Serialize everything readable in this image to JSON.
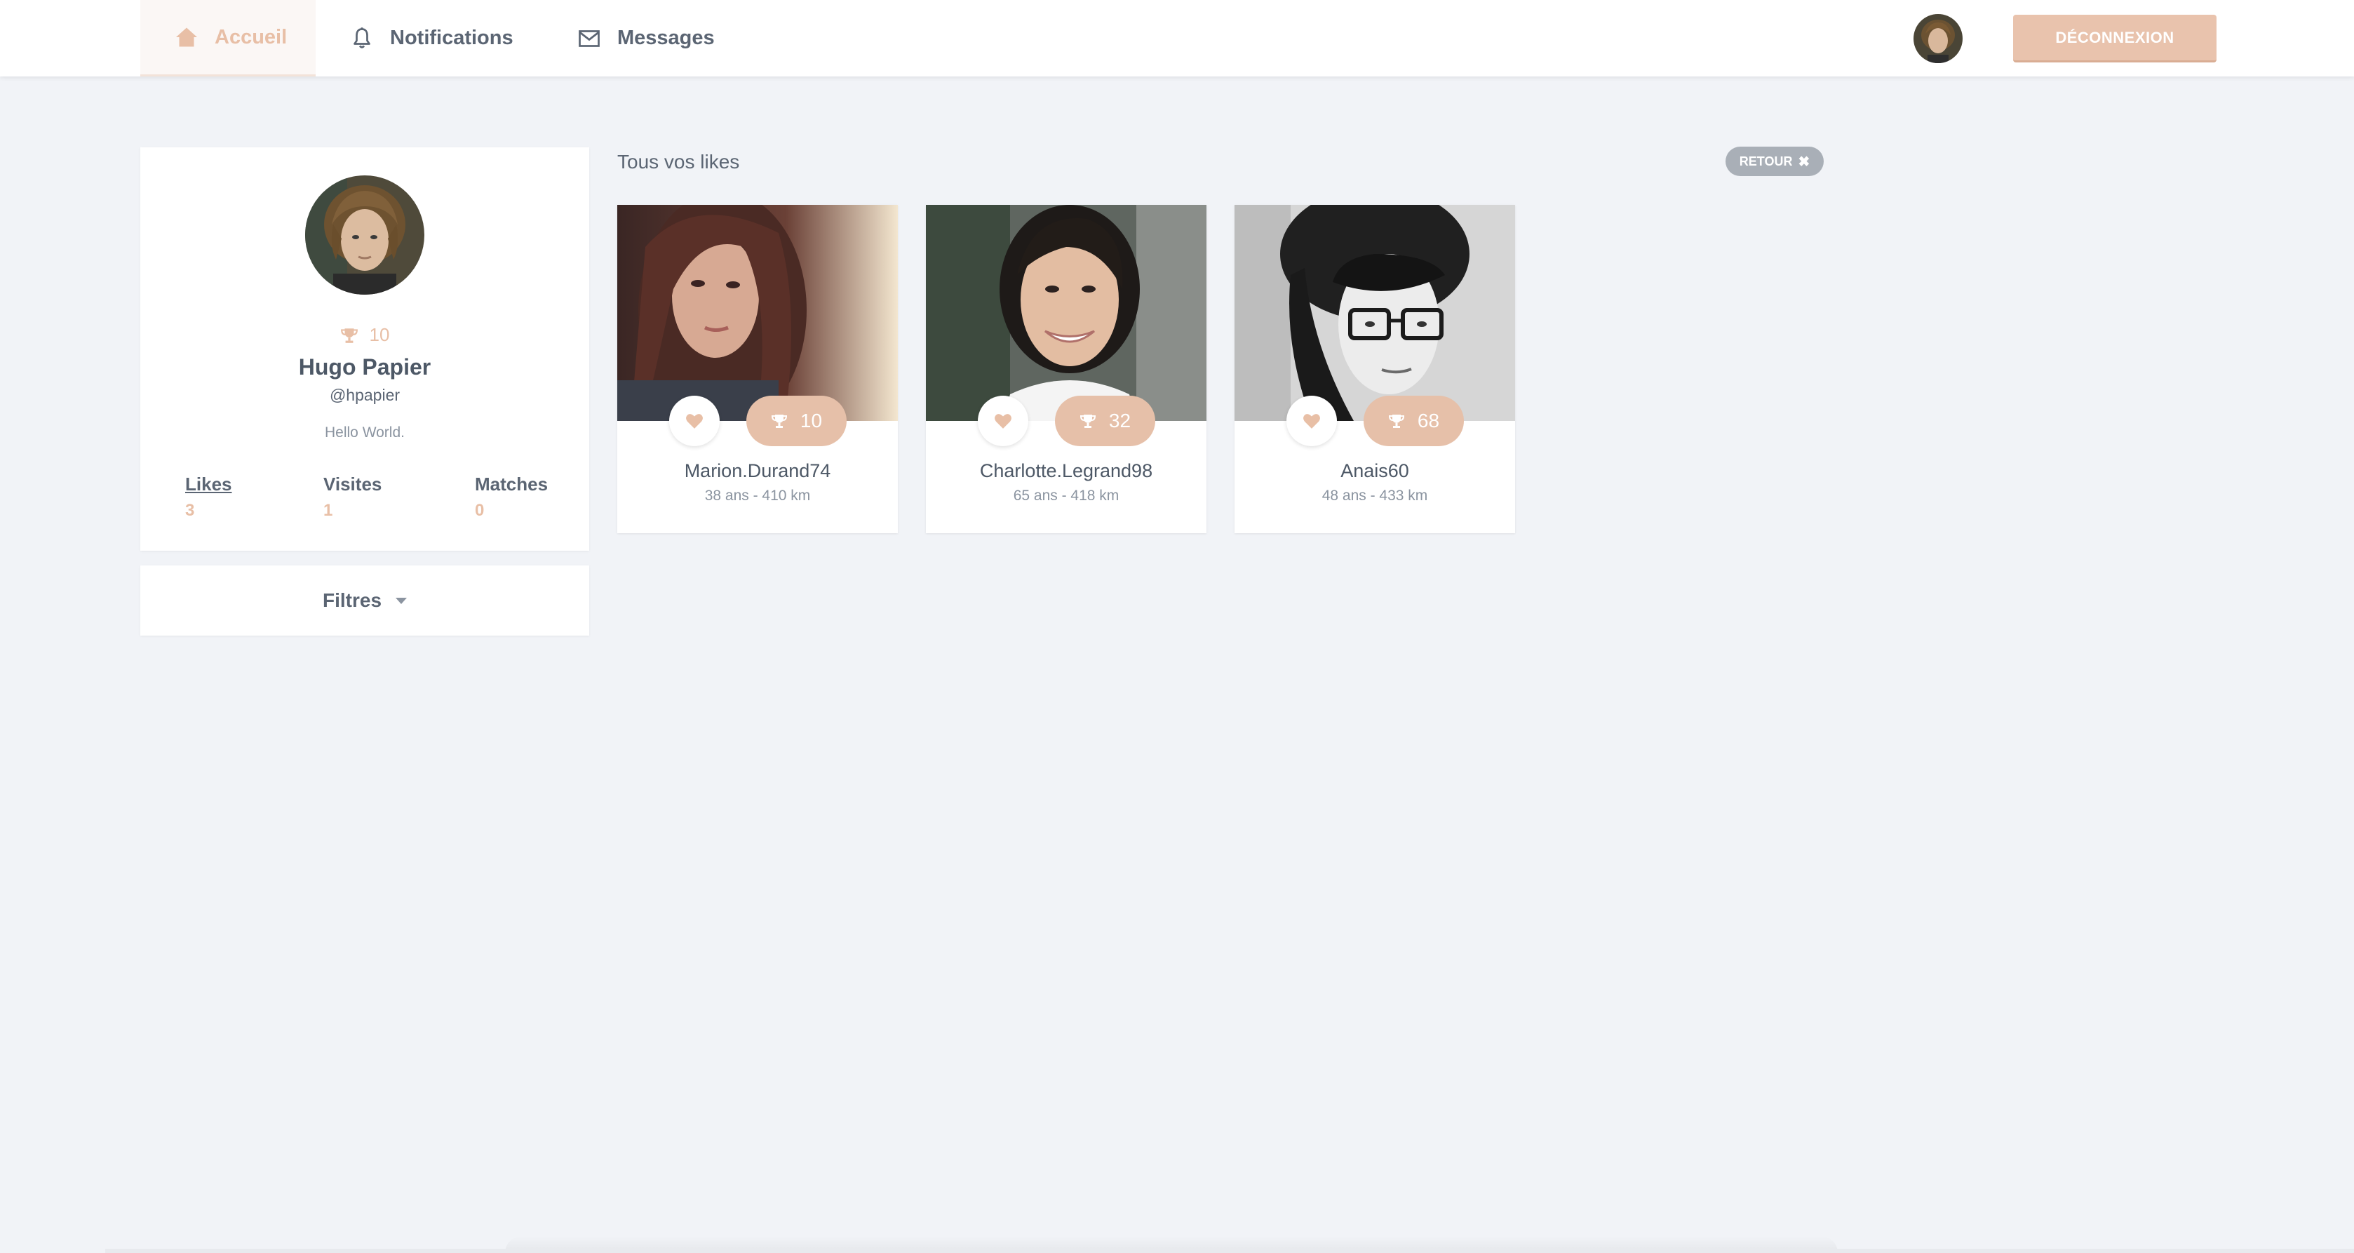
{
  "nav": {
    "home": "Accueil",
    "notifications": "Notifications",
    "messages": "Messages",
    "logout": "DÉCONNEXION"
  },
  "profile": {
    "score": "10",
    "name": "Hugo Papier",
    "handle": "@hpapier",
    "bio": "Hello World.",
    "stats": [
      {
        "label": "Likes",
        "value": "3"
      },
      {
        "label": "Visites",
        "value": "1"
      },
      {
        "label": "Matches",
        "value": "0"
      }
    ]
  },
  "filters": {
    "label": "Filtres"
  },
  "likes": {
    "title": "Tous vos likes",
    "back": "RETOUR",
    "cards": [
      {
        "name": "Marion.Durand74",
        "meta": "38 ans - 410 km",
        "score": "10"
      },
      {
        "name": "Charlotte.Legrand98",
        "meta": "65 ans - 418 km",
        "score": "32"
      },
      {
        "name": "Anais60",
        "meta": "48 ans - 433 km",
        "score": "68"
      }
    ]
  },
  "colors": {
    "accent": "#e8bfa6",
    "background": "#f1f3f7",
    "back_button": "#a9afb7"
  },
  "icons": {
    "home": "home-icon",
    "notifications": "bell-icon",
    "messages": "envelope-icon",
    "score": "trophy-icon",
    "like": "heart-icon",
    "close": "close-icon",
    "dropdown": "caret-down-icon"
  }
}
